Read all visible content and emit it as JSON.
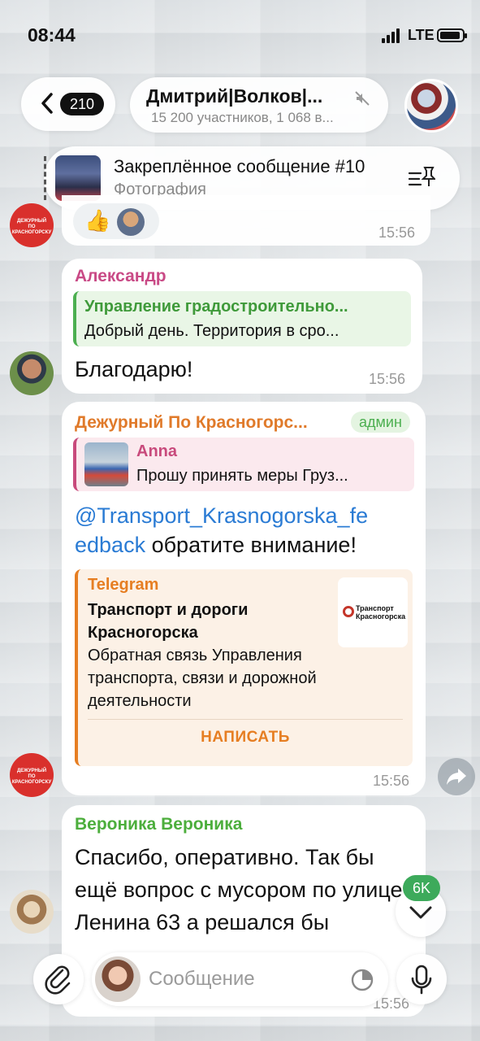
{
  "status_bar": {
    "time": "08:44",
    "network": "LTE"
  },
  "header": {
    "back_count": "210",
    "chat_title": "Дмитрий|Волков|...",
    "chat_subtitle": "15 200 участников, 1 068 в..."
  },
  "pinned": {
    "title": "Закреплённое сообщение #10",
    "subtitle": "Фотография"
  },
  "previous_message": {
    "reaction_emoji": "👍",
    "time": "15:56",
    "avatar_text_line1": "ДЕЖУРНЫЙ",
    "avatar_text_line2": "ПО КРАСНОГОРСКУ"
  },
  "messages": [
    {
      "sender": "Александр",
      "reply_title": "Управление градостроительно...",
      "reply_text": "Добрый день. Территория в сро...",
      "text": "Благодарю!",
      "time": "15:56"
    },
    {
      "sender": "Дежурный По Красногорс...",
      "badge": "админ",
      "reply_title": "Anna",
      "reply_text": "Прошу принять меры Груз...",
      "mention_line1": "@Transport_Krasnogorska_fe",
      "mention_line2": "edback",
      "text_after": " обратите внимание!",
      "preview": {
        "site": "Telegram",
        "title": "Транспорт и дороги Красногорска",
        "description": "Обратная связь Управления транспорта, связи и дорожной деятельности",
        "thumb_text_line1": "Транспорт",
        "thumb_text_line2": "Красногорска",
        "button": "НАПИСАТЬ"
      },
      "time": "15:56"
    },
    {
      "sender": "Вероника Вероника",
      "text": "Спасибо, оперативно. Так бы ещё вопрос с мусором по улице Ленина 63 а решался бы",
      "time": "15:56"
    }
  ],
  "unread_badge": "6K",
  "input": {
    "placeholder": "Сообщение"
  },
  "colors": {
    "sender_alex": "#c94a86",
    "sender_duty": "#e07a2a",
    "sender_veronika": "#4cae3c",
    "reply_green": "#3f9a3a",
    "reply_pink": "#c84a7c",
    "link": "#2a7bd4",
    "unread_badge": "#3daa5b"
  }
}
